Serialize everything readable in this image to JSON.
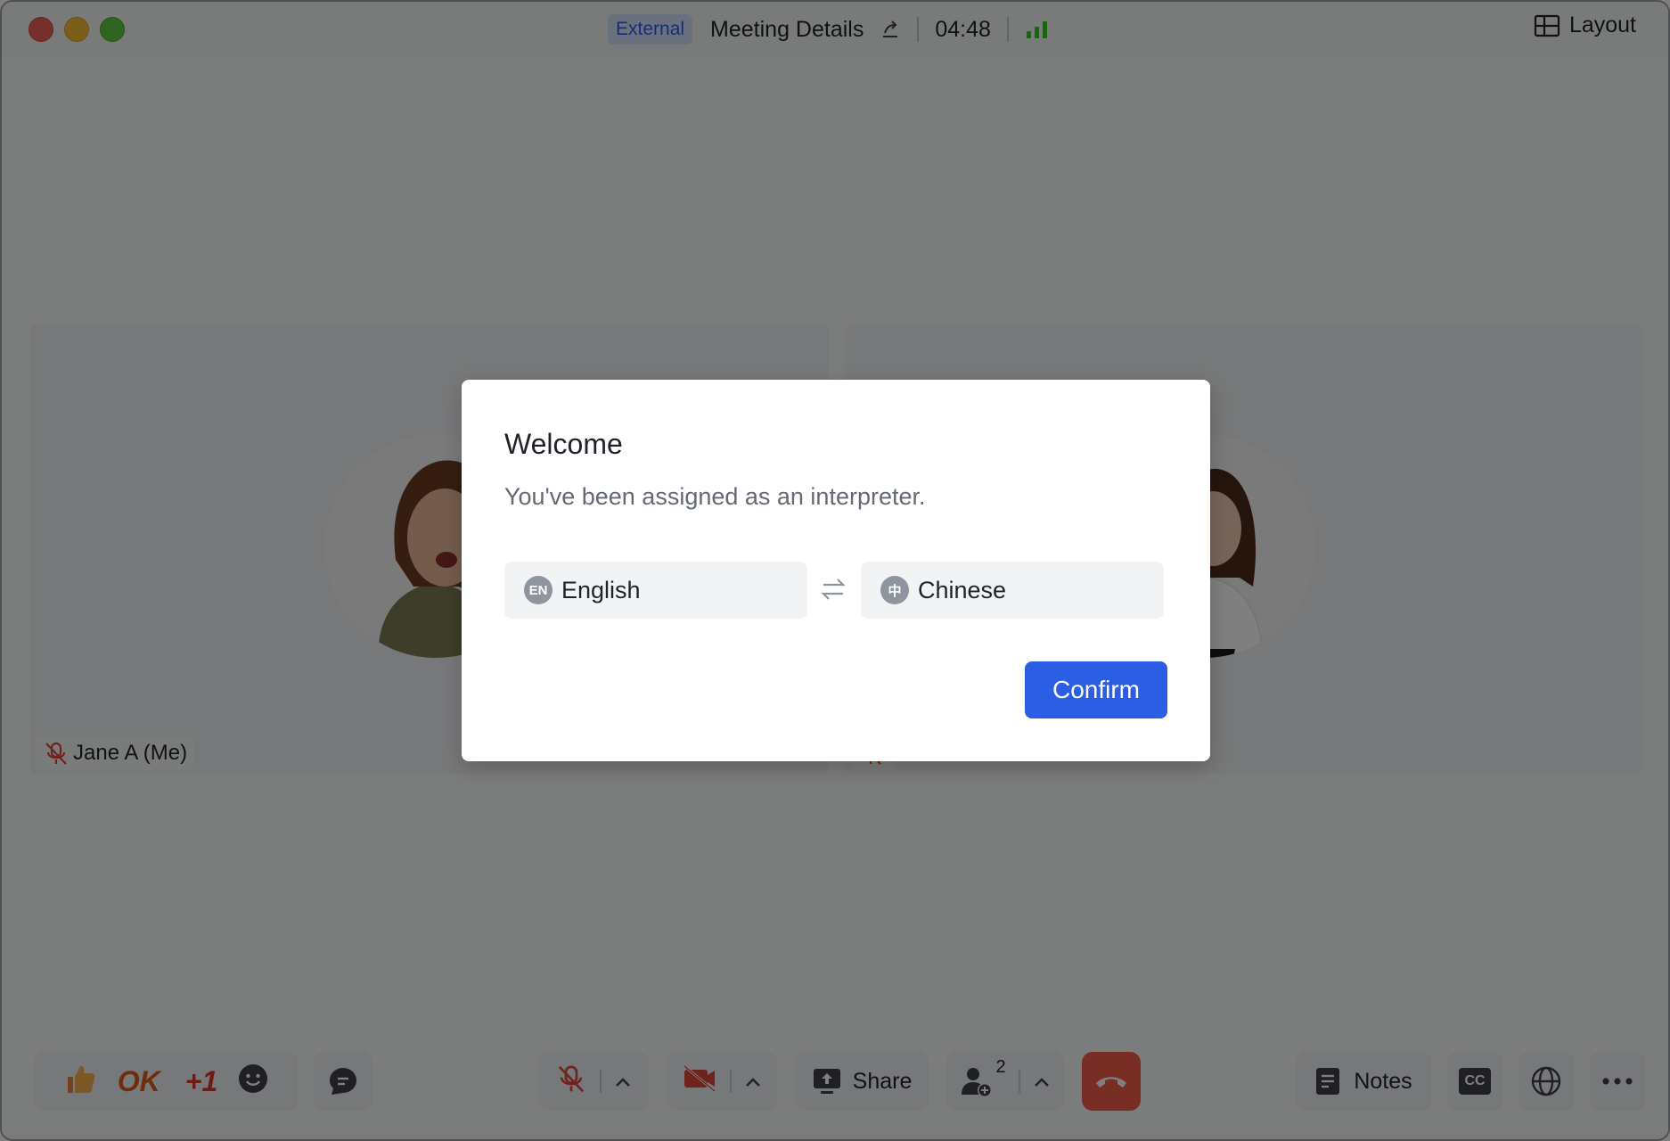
{
  "titlebar": {
    "badge": "External",
    "title": "Meeting Details",
    "timer": "04:48",
    "layout_label": "Layout"
  },
  "participants": [
    {
      "name": "Jane A (Me)"
    },
    {
      "name": ""
    }
  ],
  "bottombar": {
    "reaction_ok": "OK",
    "reaction_plus_one": "+1",
    "share_label": "Share",
    "participant_count": "2",
    "notes_label": "Notes",
    "cc_label": "CC"
  },
  "dialog": {
    "title": "Welcome",
    "subtitle": "You've been assigned as an interpreter.",
    "source_lang": {
      "code": "EN",
      "label": "English"
    },
    "target_lang": {
      "code": "中",
      "label": "Chinese"
    },
    "confirm_label": "Confirm"
  },
  "colors": {
    "accent": "#2b5de5",
    "hangup": "#f15a4a",
    "signal": "#34c724"
  }
}
